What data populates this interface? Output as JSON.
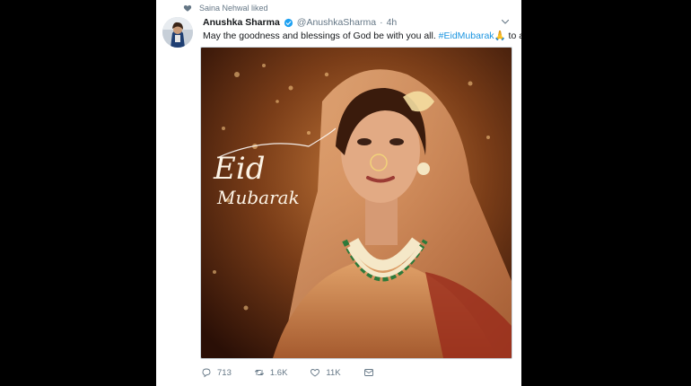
{
  "social_context": {
    "text": "Saina Nehwal liked",
    "icon": "heart-icon"
  },
  "tweet": {
    "author_name": "Anushka Sharma",
    "author_handle": "@AnushkaSharma",
    "separator": "·",
    "time": "4h",
    "text_before": "May the goodness and blessings of God be with you all. ",
    "hashtag": "#EidMubarak",
    "emoji": "🙏",
    "text_after": " to all."
  },
  "media": {
    "overlay_line1": "Eid",
    "overlay_line2": "Mubarak"
  },
  "actions": {
    "replies": "713",
    "retweets": "1.6K",
    "likes": "11K"
  },
  "colors": {
    "link": "#1b95e0",
    "secondary_text": "#657786",
    "verified": "#1da1f2",
    "background": "#000000"
  }
}
